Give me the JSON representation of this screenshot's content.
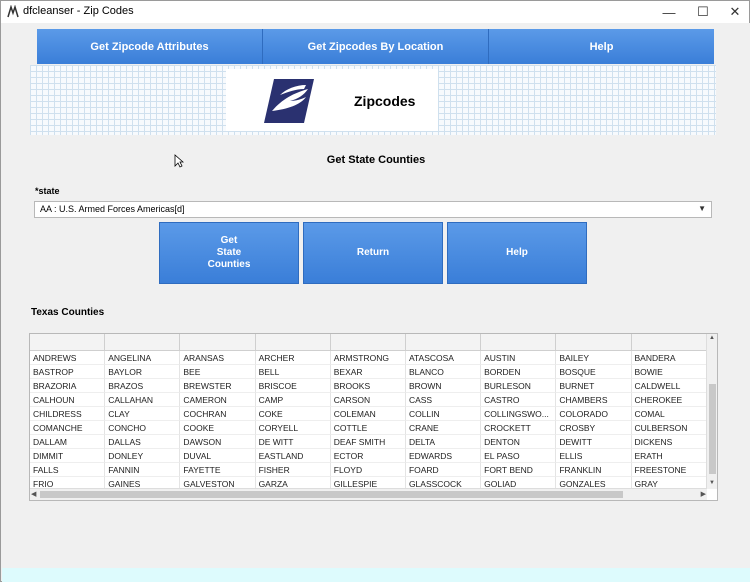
{
  "window": {
    "title": "dfcleanser - Zip Codes",
    "minimize_glyph": "—",
    "maximize_glyph": "☐",
    "close_glyph": "✕"
  },
  "navbar": {
    "items": [
      {
        "label": "Get Zipcode Attributes"
      },
      {
        "label": "Get Zipcodes By Location"
      },
      {
        "label": "Help"
      }
    ]
  },
  "banner": {
    "title": "Zipcodes",
    "logo_icon": "usps-eagle-icon"
  },
  "form": {
    "section_title": "Get State Counties",
    "state_label": "*state",
    "state_value": "AA : U.S. Armed Forces Americas[d]"
  },
  "buttons": {
    "get_state_counties_lines": [
      "Get",
      "State",
      "Counties"
    ],
    "return_label": "Return",
    "help_label": "Help"
  },
  "table": {
    "title": "Texas Counties",
    "rows": [
      [
        "ANDREWS",
        "ANGELINA",
        "ARANSAS",
        "ARCHER",
        "ARMSTRONG",
        "ATASCOSA",
        "AUSTIN",
        "BAILEY",
        "BANDERA"
      ],
      [
        "BASTROP",
        "BAYLOR",
        "BEE",
        "BELL",
        "BEXAR",
        "BLANCO",
        "BORDEN",
        "BOSQUE",
        "BOWIE"
      ],
      [
        "BRAZORIA",
        "BRAZOS",
        "BREWSTER",
        "BRISCOE",
        "BROOKS",
        "BROWN",
        "BURLESON",
        "BURNET",
        "CALDWELL"
      ],
      [
        "CALHOUN",
        "CALLAHAN",
        "CAMERON",
        "CAMP",
        "CARSON",
        "CASS",
        "CASTRO",
        "CHAMBERS",
        "CHEROKEE"
      ],
      [
        "CHILDRESS",
        "CLAY",
        "COCHRAN",
        "COKE",
        "COLEMAN",
        "COLLIN",
        "COLLINGSWO...",
        "COLORADO",
        "COMAL"
      ],
      [
        "COMANCHE",
        "CONCHO",
        "COOKE",
        "CORYELL",
        "COTTLE",
        "CRANE",
        "CROCKETT",
        "CROSBY",
        "CULBERSON"
      ],
      [
        "DALLAM",
        "DALLAS",
        "DAWSON",
        "DE WITT",
        "DEAF SMITH",
        "DELTA",
        "DENTON",
        "DEWITT",
        "DICKENS"
      ],
      [
        "DIMMIT",
        "DONLEY",
        "DUVAL",
        "EASTLAND",
        "ECTOR",
        "EDWARDS",
        "EL PASO",
        "ELLIS",
        "ERATH"
      ],
      [
        "FALLS",
        "FANNIN",
        "FAYETTE",
        "FISHER",
        "FLOYD",
        "FOARD",
        "FORT BEND",
        "FRANKLIN",
        "FREESTONE"
      ],
      [
        "FRIO",
        "GAINES",
        "GALVESTON",
        "GARZA",
        "GILLESPIE",
        "GLASSCOCK",
        "GOLIAD",
        "GONZALES",
        "GRAY"
      ]
    ]
  },
  "colors": {
    "button_blue": "#3a7ed8",
    "bottom_strip": "#ddfbfd"
  }
}
